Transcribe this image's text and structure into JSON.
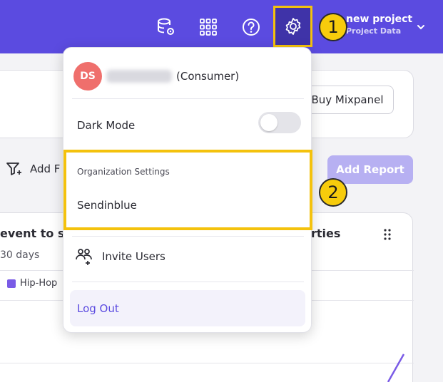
{
  "topbar": {
    "icons": [
      "database-settings-icon",
      "apps-grid-icon",
      "help-icon",
      "settings-gear-icon"
    ],
    "project_name": "new project",
    "project_sub": "Project Data",
    "highlight_color": "#f4c20d",
    "bar_color": "#5b4be0"
  },
  "annotations": {
    "step1": "1",
    "step2": "2"
  },
  "background": {
    "buy_button": "Buy Mixpanel",
    "add_filter": "Add F",
    "add_report": "Add Report",
    "card_title_left": "event to se",
    "card_title_right": "rties",
    "card_subtitle": "30 days",
    "legend_item": "Hip-Hop"
  },
  "menu": {
    "avatar_initials": "DS",
    "role": "(Consumer)",
    "dark_mode_label": "Dark Mode",
    "dark_mode_on": false,
    "org_settings_header": "Organization Settings",
    "org_name": "Sendinblue",
    "invite_users": "Invite Users",
    "log_out": "Log Out"
  }
}
